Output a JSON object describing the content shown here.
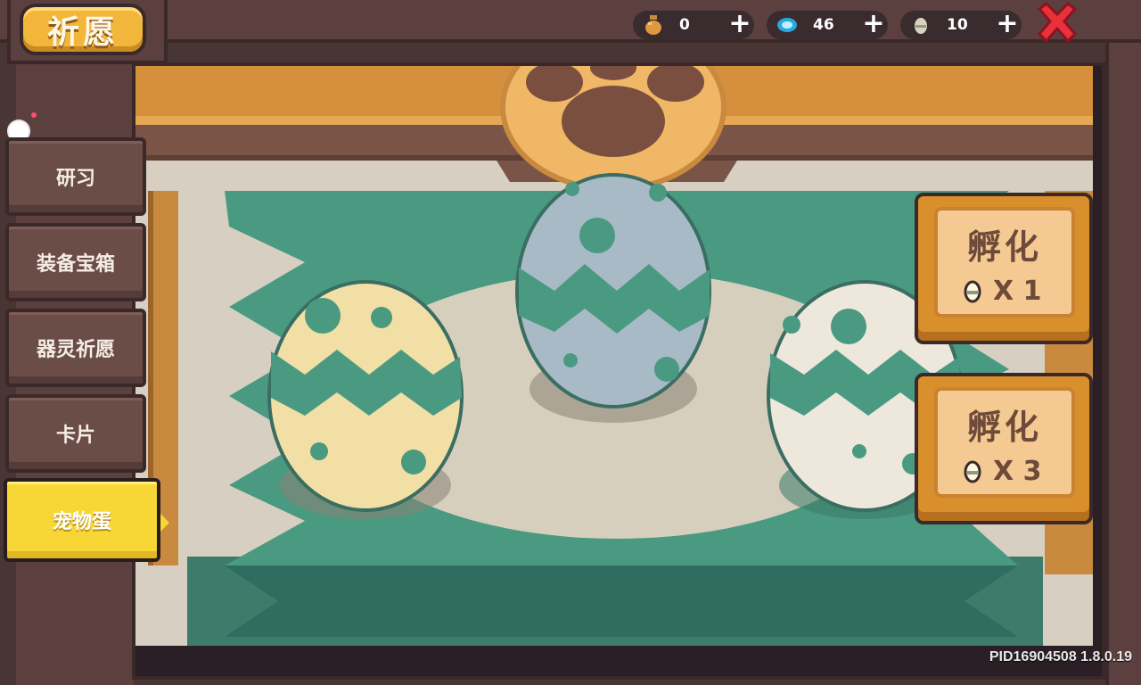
{
  "title": "祈愿",
  "currencies": [
    {
      "icon": "bottle-icon",
      "value": "0"
    },
    {
      "icon": "gem-icon",
      "value": "46"
    },
    {
      "icon": "egg-icon",
      "value": "10"
    }
  ],
  "plus_label": "+",
  "sidebar": {
    "tabs": [
      {
        "label": "研习"
      },
      {
        "label": "装备宝箱"
      },
      {
        "label": "器灵祈愿"
      },
      {
        "label": "卡片"
      },
      {
        "label": "宠物蛋"
      }
    ],
    "active_index": 4
  },
  "hatch_buttons": [
    {
      "label": "孵化",
      "cost": "X 1"
    },
    {
      "label": "孵化",
      "cost": "X 3"
    }
  ],
  "version": "PID16904508 1.8.0.19",
  "colors": {
    "accent": "#f7d636",
    "close": "#e8313a",
    "teal": "#4a9a82"
  }
}
